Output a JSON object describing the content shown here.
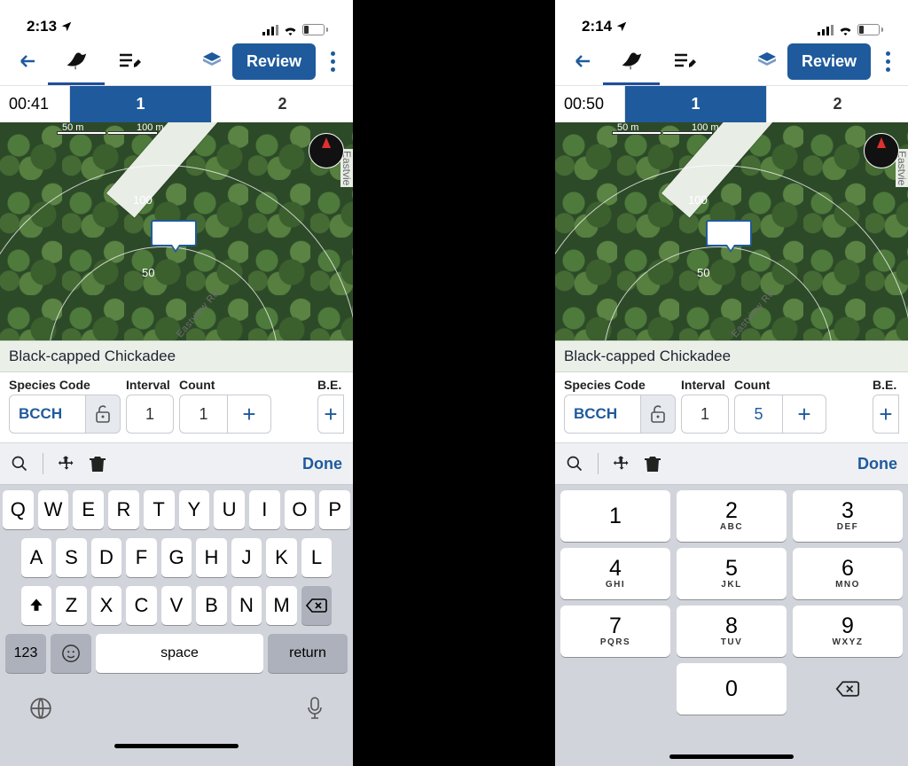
{
  "left": {
    "status": {
      "time": "2:13",
      "battery": "24"
    },
    "toolbar": {
      "review": "Review"
    },
    "tabs": {
      "timer": "00:41",
      "t1": "1",
      "t2": "2"
    },
    "map": {
      "scale_a": "50 m",
      "scale_b": "100 m",
      "ring50": "50",
      "ring100": "100",
      "road": "Eastview Rd",
      "road_side": "Eastvie"
    },
    "species": {
      "name": "Black-capped Chickadee"
    },
    "form": {
      "code_label": "Species Code",
      "code_value": "BCCH",
      "interval_label": "Interval",
      "interval_value": "1",
      "count_label": "Count",
      "count_value": "1",
      "be_label": "B.E."
    },
    "acc": {
      "done": "Done"
    },
    "kb": {
      "r1": [
        "Q",
        "W",
        "E",
        "R",
        "T",
        "Y",
        "U",
        "I",
        "O",
        "P"
      ],
      "r2": [
        "A",
        "S",
        "D",
        "F",
        "G",
        "H",
        "J",
        "K",
        "L"
      ],
      "r3": [
        "Z",
        "X",
        "C",
        "V",
        "B",
        "N",
        "M"
      ],
      "n123": "123",
      "space": "space",
      "return": "return"
    }
  },
  "right": {
    "status": {
      "time": "2:14",
      "battery": "24"
    },
    "toolbar": {
      "review": "Review"
    },
    "tabs": {
      "timer": "00:50",
      "t1": "1",
      "t2": "2"
    },
    "map": {
      "scale_a": "50 m",
      "scale_b": "100 m",
      "ring50": "50",
      "ring100": "100",
      "road": "Eastview Rd",
      "road_side": "Eastvie"
    },
    "species": {
      "name": "Black-capped Chickadee"
    },
    "form": {
      "code_label": "Species Code",
      "code_value": "BCCH",
      "interval_label": "Interval",
      "interval_value": "1",
      "count_label": "Count",
      "count_value": "5",
      "be_label": "B.E."
    },
    "acc": {
      "done": "Done"
    },
    "np": {
      "keys": [
        {
          "n": "1",
          "s": ""
        },
        {
          "n": "2",
          "s": "ABC"
        },
        {
          "n": "3",
          "s": "DEF"
        },
        {
          "n": "4",
          "s": "GHI"
        },
        {
          "n": "5",
          "s": "JKL"
        },
        {
          "n": "6",
          "s": "MNO"
        },
        {
          "n": "7",
          "s": "PQRS"
        },
        {
          "n": "8",
          "s": "TUV"
        },
        {
          "n": "9",
          "s": "WXYZ"
        },
        {
          "n": "0",
          "s": ""
        }
      ]
    }
  }
}
